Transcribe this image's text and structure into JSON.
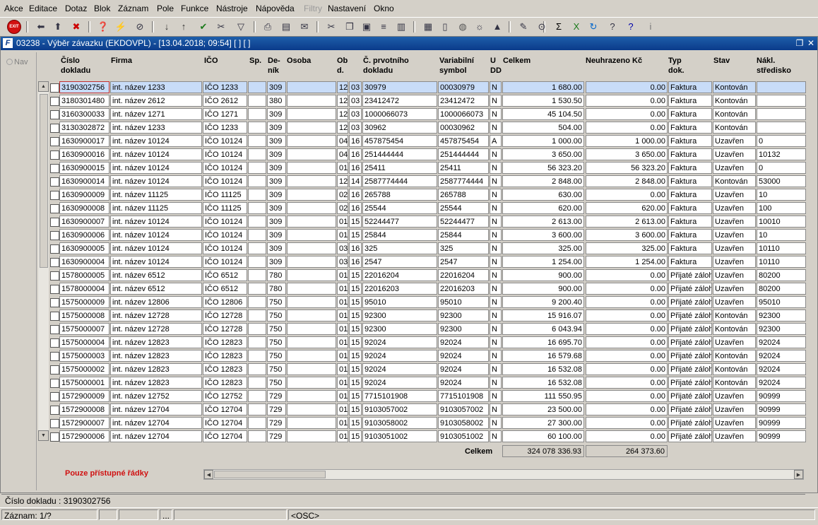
{
  "menu": [
    "Akce",
    "Editace",
    "Dotaz",
    "Blok",
    "Záznam",
    "Pole",
    "Funkce",
    "Nástroje",
    "Nápověda",
    "Filtry",
    "Nastavení",
    "Okno"
  ],
  "toolbar": {
    "exit_label": "EXIT",
    "icons": [
      "exit-icon",
      "insert-record-icon",
      "save-record-icon",
      "delete-record-icon",
      "query-icon",
      "execute-query-icon",
      "cancel-query-icon",
      "sort-asc-icon",
      "sort-desc-icon",
      "confirm-icon",
      "tools-icon",
      "filter-icon",
      "print-icon",
      "print-preview-icon",
      "email-icon",
      "cut-icon",
      "copy-icon",
      "paste-icon",
      "list-icon",
      "columns-icon",
      "calendar-icon",
      "notes-icon",
      "globe-icon",
      "settings-icon",
      "chart-icon",
      "edit-icon",
      "attachment-icon",
      "sum-icon",
      "excel-icon",
      "refresh-icon",
      "help-query-icon",
      "help-icon",
      "info-icon"
    ]
  },
  "window": {
    "title": "03238 - Výběr závazku (EKDOVPL) - [13.04.2018; 09:54]  [ ]  [ ]",
    "icon": "F"
  },
  "nav_label": "Nav",
  "columns": {
    "cislo": "Číslo\ndokladu",
    "firma": "Firma",
    "ico": "IČO",
    "sp": "Sp.",
    "denik": "De-\nník",
    "osoba": "Osoba",
    "obd": "Ob\nd.",
    "c_prvotniho": "Č. prvotního\ndokladu",
    "variabilni": "Variabilní\nsymbol",
    "udd": "U\nDD",
    "celkem": "Celkem",
    "neuhrazeno": "Neuhrazeno Kč",
    "typ": "Typ\ndok.",
    "stav": "Stav",
    "nakl": "Nákl.\nstředisko"
  },
  "rows": [
    [
      "3190302756",
      "int. název 1233",
      "IČO 1233",
      "",
      "309",
      "",
      "12",
      "03",
      "30979",
      "00030979",
      "N",
      "1 680.00",
      "0.00",
      "Faktura",
      "Kontován",
      ""
    ],
    [
      "3180301480",
      "int. název 2612",
      "IČO 2612",
      "",
      "380",
      "",
      "12",
      "03",
      "23412472",
      "23412472",
      "N",
      "1 530.50",
      "0.00",
      "Faktura",
      "Kontován",
      ""
    ],
    [
      "3160300033",
      "int. název 1271",
      "IČO 1271",
      "",
      "309",
      "",
      "12",
      "03",
      "1000066073",
      "1000066073",
      "N",
      "45 104.50",
      "0.00",
      "Faktura",
      "Kontován",
      ""
    ],
    [
      "3130302872",
      "int. název 1233",
      "IČO 1233",
      "",
      "309",
      "",
      "12",
      "03",
      "30962",
      "00030962",
      "N",
      "504.00",
      "0.00",
      "Faktura",
      "Kontován",
      ""
    ],
    [
      "1630900017",
      "int. název 10124",
      "IČO 10124",
      "",
      "309",
      "",
      "04",
      "16",
      "457875454",
      "457875454",
      "A",
      "1 000.00",
      "1 000.00",
      "Faktura",
      "Uzavřen",
      "0"
    ],
    [
      "1630900016",
      "int. název 10124",
      "IČO 10124",
      "",
      "309",
      "",
      "04",
      "16",
      "251444444",
      "251444444",
      "N",
      "3 650.00",
      "3 650.00",
      "Faktura",
      "Uzavřen",
      "10132"
    ],
    [
      "1630900015",
      "int. název 10124",
      "IČO 10124",
      "",
      "309",
      "",
      "01",
      "16",
      "25411",
      "25411",
      "N",
      "56 323.20",
      "56 323.20",
      "Faktura",
      "Uzavřen",
      "0"
    ],
    [
      "1630900014",
      "int. název 10124",
      "IČO 10124",
      "",
      "309",
      "",
      "12",
      "14",
      "2587774444",
      "2587774444",
      "N",
      "2 848.00",
      "2 848.00",
      "Faktura",
      "Kontován",
      "53000"
    ],
    [
      "1630900009",
      "int. název 11125",
      "IČO 11125",
      "",
      "309",
      "",
      "02",
      "16",
      "265788",
      "265788",
      "N",
      "630.00",
      "0.00",
      "Faktura",
      "Uzavřen",
      "10"
    ],
    [
      "1630900008",
      "int. název 11125",
      "IČO 11125",
      "",
      "309",
      "",
      "02",
      "16",
      "25544",
      "25544",
      "N",
      "620.00",
      "620.00",
      "Faktura",
      "Uzavřen",
      "100"
    ],
    [
      "1630900007",
      "int. název 10124",
      "IČO 10124",
      "",
      "309",
      "",
      "01",
      "15",
      "52244477",
      "52244477",
      "N",
      "2 613.00",
      "2 613.00",
      "Faktura",
      "Uzavřen",
      "10010"
    ],
    [
      "1630900006",
      "int. název 10124",
      "IČO 10124",
      "",
      "309",
      "",
      "01",
      "15",
      "25844",
      "25844",
      "N",
      "3 600.00",
      "3 600.00",
      "Faktura",
      "Uzavřen",
      "10"
    ],
    [
      "1630900005",
      "int. název 10124",
      "IČO 10124",
      "",
      "309",
      "",
      "03",
      "16",
      "325",
      "325",
      "N",
      "325.00",
      "325.00",
      "Faktura",
      "Uzavřen",
      "10110"
    ],
    [
      "1630900004",
      "int. název 10124",
      "IČO 10124",
      "",
      "309",
      "",
      "03",
      "16",
      "2547",
      "2547",
      "N",
      "1 254.00",
      "1 254.00",
      "Faktura",
      "Uzavřen",
      "10110"
    ],
    [
      "1578000005",
      "int. název 6512",
      "IČO 6512",
      "",
      "780",
      "",
      "01",
      "15",
      "22016204",
      "22016204",
      "N",
      "900.00",
      "0.00",
      "Přijaté záloh",
      "Uzavřen",
      "80200"
    ],
    [
      "1578000004",
      "int. název 6512",
      "IČO 6512",
      "",
      "780",
      "",
      "01",
      "15",
      "22016203",
      "22016203",
      "N",
      "900.00",
      "0.00",
      "Přijaté záloh",
      "Uzavřen",
      "80200"
    ],
    [
      "1575000009",
      "int. název 12806",
      "IČO 12806",
      "",
      "750",
      "",
      "01",
      "15",
      "95010",
      "95010",
      "N",
      "9 200.40",
      "0.00",
      "Přijaté záloh",
      "Uzavřen",
      "95010"
    ],
    [
      "1575000008",
      "int. název 12728",
      "IČO 12728",
      "",
      "750",
      "",
      "01",
      "15",
      "92300",
      "92300",
      "N",
      "15 916.07",
      "0.00",
      "Přijaté záloh",
      "Kontován",
      "92300"
    ],
    [
      "1575000007",
      "int. název 12728",
      "IČO 12728",
      "",
      "750",
      "",
      "01",
      "15",
      "92300",
      "92300",
      "N",
      "6 043.94",
      "0.00",
      "Přijaté záloh",
      "Kontován",
      "92300"
    ],
    [
      "1575000004",
      "int. název 12823",
      "IČO 12823",
      "",
      "750",
      "",
      "01",
      "15",
      "92024",
      "92024",
      "N",
      "16 695.70",
      "0.00",
      "Přijaté záloh",
      "Uzavřen",
      "92024"
    ],
    [
      "1575000003",
      "int. název 12823",
      "IČO 12823",
      "",
      "750",
      "",
      "01",
      "15",
      "92024",
      "92024",
      "N",
      "16 579.68",
      "0.00",
      "Přijaté záloh",
      "Kontován",
      "92024"
    ],
    [
      "1575000002",
      "int. název 12823",
      "IČO 12823",
      "",
      "750",
      "",
      "01",
      "15",
      "92024",
      "92024",
      "N",
      "16 532.08",
      "0.00",
      "Přijaté záloh",
      "Kontován",
      "92024"
    ],
    [
      "1575000001",
      "int. název 12823",
      "IČO 12823",
      "",
      "750",
      "",
      "01",
      "15",
      "92024",
      "92024",
      "N",
      "16 532.08",
      "0.00",
      "Přijaté záloh",
      "Kontován",
      "92024"
    ],
    [
      "1572900009",
      "int. název 12752",
      "IČO 12752",
      "",
      "729",
      "",
      "01",
      "15",
      "7715101908",
      "7715101908",
      "N",
      "111 550.95",
      "0.00",
      "Přijaté záloh",
      "Uzavřen",
      "90999"
    ],
    [
      "1572900008",
      "int. název 12704",
      "IČO 12704",
      "",
      "729",
      "",
      "01",
      "15",
      "9103057002",
      "9103057002",
      "N",
      "23 500.00",
      "0.00",
      "Přijaté záloh",
      "Uzavřen",
      "90999"
    ],
    [
      "1572900007",
      "int. název 12704",
      "IČO 12704",
      "",
      "729",
      "",
      "01",
      "15",
      "9103058002",
      "9103058002",
      "N",
      "27 300.00",
      "0.00",
      "Přijaté záloh",
      "Uzavřen",
      "90999"
    ],
    [
      "1572900006",
      "int. název 12704",
      "IČO 12704",
      "",
      "729",
      "",
      "01",
      "15",
      "9103051002",
      "9103051002",
      "N",
      "60 100.00",
      "0.00",
      "Přijaté záloh",
      "Uzavřen",
      "90999"
    ]
  ],
  "totals": {
    "label": "Celkem",
    "celkem": "324 078 336.93",
    "neuhrazeno": "264 373.60"
  },
  "note": "Pouze přístupné řádky",
  "status": {
    "field": "Číslo dokladu : 3190302756",
    "record": "Záznam: 1/?",
    "dots": "...",
    "osc": "<OSC>"
  }
}
